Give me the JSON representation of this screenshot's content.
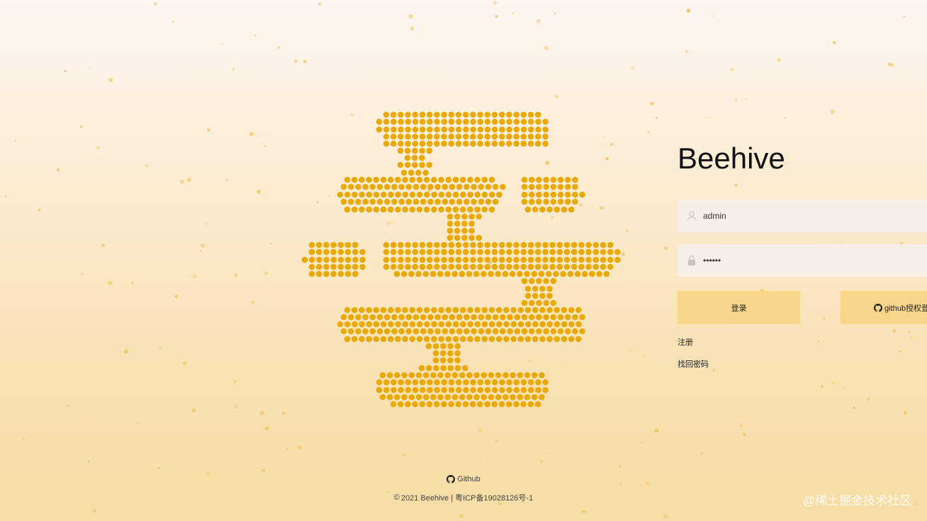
{
  "colors": {
    "accent": "#f9d68a",
    "logo_dot": "#e9aa09",
    "speck": "#f3c65f"
  },
  "logo": {
    "icon": "beehive-dot-logo"
  },
  "login": {
    "title": "Beehive",
    "username": {
      "value": "admin",
      "icon": "user-icon"
    },
    "password": {
      "value": "••••••",
      "icon": "lock-icon"
    },
    "login_button": "登录",
    "github_button": {
      "label": "github授权登录",
      "icon": "github-icon"
    },
    "register_link": "注册",
    "recover_link": "找回密码"
  },
  "footer": {
    "github_link": "Github",
    "copyright_symbol": "©",
    "copyright": "2021 Beehive | 粤ICP备19028126号-1"
  },
  "watermark": "@稀土掘金技术社区"
}
